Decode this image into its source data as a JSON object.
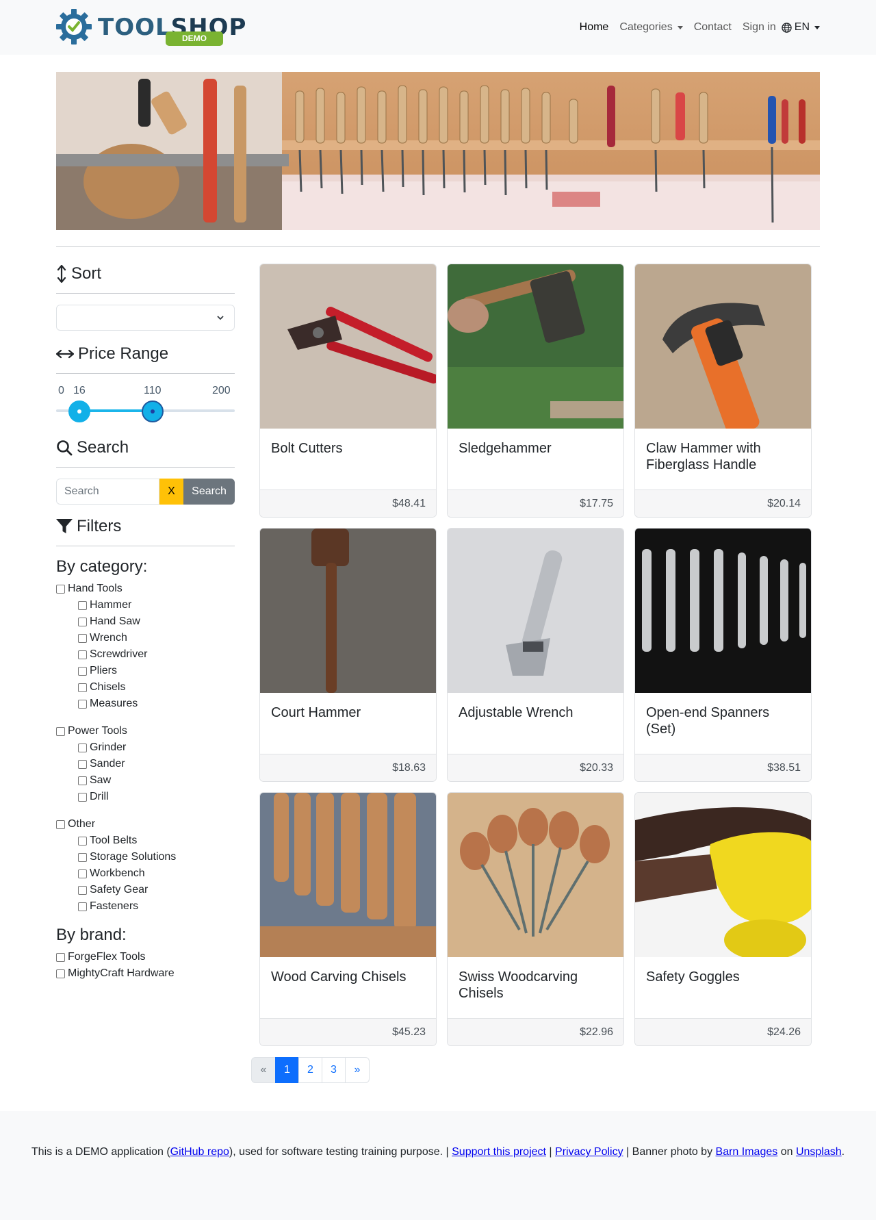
{
  "brand": {
    "word_tool": "TOOL",
    "word_shop": "SHOP",
    "badge": "DEMO"
  },
  "nav": {
    "home": "Home",
    "categories": "Categories",
    "contact": "Contact",
    "signin": "Sign in",
    "language": "EN"
  },
  "sidebar": {
    "sort_heading": "Sort",
    "sort_value": "",
    "price_heading": "Price Range",
    "price": {
      "min": "0",
      "max": "200",
      "low": "16",
      "high": "110",
      "low_value": 16,
      "high_value": 110
    },
    "search_heading": "Search",
    "search_placeholder": "Search",
    "clear_label": "X",
    "search_button": "Search",
    "filters_heading": "Filters",
    "by_category": "By category:",
    "categories": [
      {
        "label": "Hand Tools",
        "children": [
          "Hammer",
          "Hand Saw",
          "Wrench",
          "Screwdriver",
          "Pliers",
          "Chisels",
          "Measures"
        ]
      },
      {
        "label": "Power Tools",
        "children": [
          "Grinder",
          "Sander",
          "Saw",
          "Drill"
        ]
      },
      {
        "label": "Other",
        "children": [
          "Tool Belts",
          "Storage Solutions",
          "Workbench",
          "Safety Gear",
          "Fasteners"
        ]
      }
    ],
    "by_brand": "By brand:",
    "brands": [
      "ForgeFlex Tools",
      "MightyCraft Hardware"
    ]
  },
  "products": [
    {
      "name": "Bolt Cutters",
      "price": "$48.41"
    },
    {
      "name": "Sledgehammer",
      "price": "$17.75"
    },
    {
      "name": "Claw Hammer with Fiberglass Handle",
      "price": "$20.14"
    },
    {
      "name": "Court Hammer",
      "price": "$18.63"
    },
    {
      "name": "Adjustable Wrench",
      "price": "$20.33"
    },
    {
      "name": "Open-end Spanners (Set)",
      "price": "$38.51"
    },
    {
      "name": "Wood Carving Chisels",
      "price": "$45.23"
    },
    {
      "name": "Swiss Woodcarving Chisels",
      "price": "$22.96"
    },
    {
      "name": "Safety Goggles",
      "price": "$24.26"
    }
  ],
  "pagination": {
    "prev": "«",
    "pages": [
      "1",
      "2",
      "3"
    ],
    "current": "1",
    "next": "»"
  },
  "footer": {
    "t1": "This is a DEMO application (",
    "github": "GitHub repo",
    "t2": "), used for software testing training purpose. | ",
    "support": "Support this project",
    "t3": " | ",
    "privacy": "Privacy Policy",
    "t4": " | Banner photo by ",
    "barn": "Barn Images",
    "t5": " on ",
    "unsplash": "Unsplash",
    "t6": "."
  }
}
